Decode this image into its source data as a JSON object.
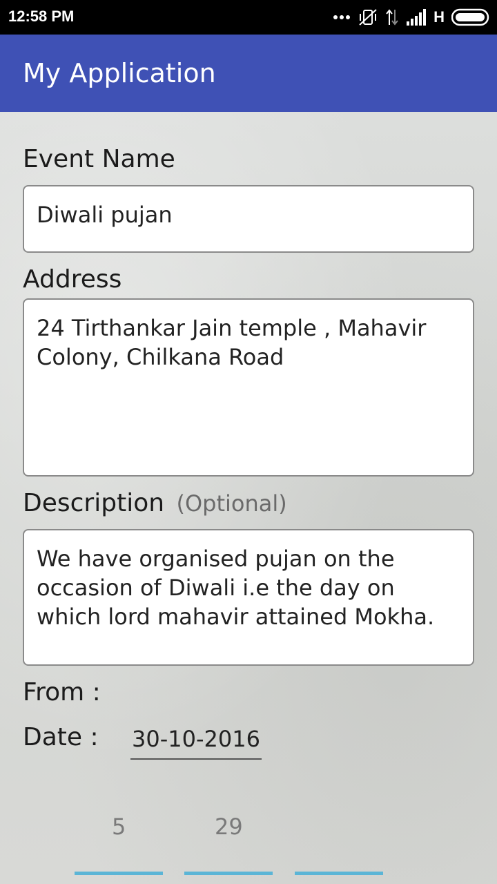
{
  "status_bar": {
    "time": "12:58 PM",
    "network_type": "H",
    "icons": [
      "more-dots-icon",
      "mute-vibrate-icon",
      "data-arrows-icon",
      "signal-icon",
      "battery-icon"
    ]
  },
  "app_bar": {
    "title": "My Application",
    "color": "#3f51b5"
  },
  "form": {
    "event_name": {
      "label": "Event Name",
      "value": "Diwali pujan"
    },
    "address": {
      "label": "Address",
      "value": "24 Tirthankar Jain temple , Mahavir Colony, Chilkana Road"
    },
    "description": {
      "label": "Description",
      "optional_hint": "(Optional)",
      "value": "We have organised pujan on the occasion of Diwali i.e the day on which lord mahavir attained Mokha."
    },
    "from": {
      "label": "From :",
      "date_label": "Date :",
      "date_value": "30-10-2016",
      "time_values": [
        "5",
        "29"
      ]
    }
  }
}
